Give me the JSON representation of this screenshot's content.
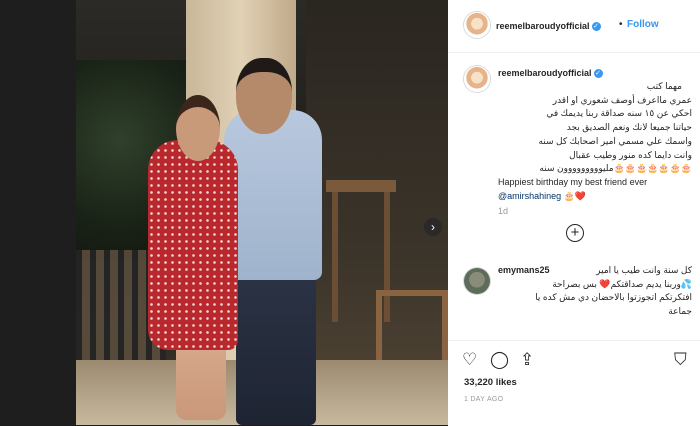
{
  "post": {
    "username": "reemelbaroudyofficial",
    "follow_label": "Follow",
    "separator": "•",
    "verified_mark": "✓",
    "photo_alt": "Post photo"
  },
  "caption": {
    "lines_rtl": [
      "مهما كتب",
      "عمري مااعرف أوصف شعوري او اقدر",
      "احكي عن ١٥ سنه صداقة ربنا يديمك في",
      "حياتنا جميعا لانك ونعم الصديق بجد",
      "واسمك علي مسمي امير اصحابك كل سنه",
      "وانت دايما كده منور وطيب عقبال",
      "🎂🎂🎂🎂🎂🎂🎂ملیووووووووون سنه"
    ],
    "english_line": "Happiest birthday my best friend ever",
    "mention": "@amirshahineg",
    "emoji_after_mention": "🎂❤️",
    "age": "1d"
  },
  "comment": {
    "username": "emymans25",
    "lines_rtl": [
      "كل سنة وانت طيب يا امير",
      "💦وربنا يديم صداقتكم❤️ بس بصراحة",
      "افتكرتكم اتجوزتوا بالاحضان دي مش كده يا",
      "جماعة"
    ]
  },
  "actions": {
    "like_icon": "heart-icon",
    "comment_icon": "comment-icon",
    "share_icon": "share-icon",
    "save_icon": "bookmark-icon",
    "likes": "33,220 likes",
    "time": "1 DAY AGO"
  },
  "navigation": {
    "next_glyph": "›"
  }
}
